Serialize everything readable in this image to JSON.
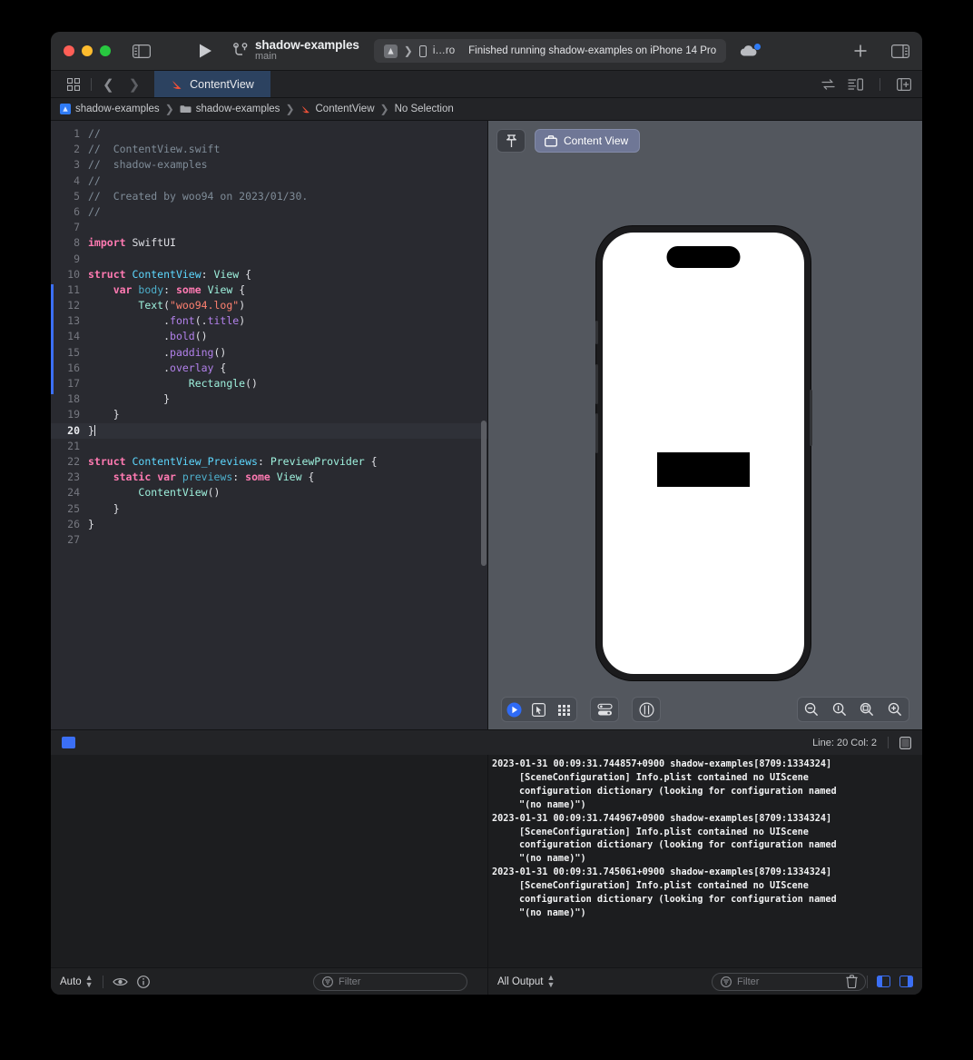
{
  "window": {
    "titlebar": {
      "scheme_name": "shadow-examples",
      "branch": "main",
      "activity": {
        "target": "i…ro",
        "status": "Finished running shadow-examples on iPhone 14 Pro"
      }
    },
    "tabbar": {
      "active_tab": "ContentView"
    },
    "breadcrumb": {
      "items": [
        "shadow-examples",
        "shadow-examples",
        "ContentView",
        "No Selection"
      ]
    }
  },
  "editor": {
    "lines": [
      {
        "n": "1",
        "tokens": [
          {
            "t": "//",
            "c": "c-cmt"
          }
        ]
      },
      {
        "n": "2",
        "tokens": [
          {
            "t": "//  ContentView.swift",
            "c": "c-cmt"
          }
        ]
      },
      {
        "n": "3",
        "tokens": [
          {
            "t": "//  shadow-examples",
            "c": "c-cmt"
          }
        ]
      },
      {
        "n": "4",
        "tokens": [
          {
            "t": "//",
            "c": "c-cmt"
          }
        ]
      },
      {
        "n": "5",
        "tokens": [
          {
            "t": "//  Created by woo94 on 2023/01/30.",
            "c": "c-cmt"
          }
        ]
      },
      {
        "n": "6",
        "tokens": [
          {
            "t": "//",
            "c": "c-cmt"
          }
        ]
      },
      {
        "n": "7",
        "tokens": []
      },
      {
        "n": "8",
        "tokens": [
          {
            "t": "import",
            "c": "c-kw"
          },
          {
            "t": " ",
            "c": "c-plain"
          },
          {
            "t": "SwiftUI",
            "c": "c-plain"
          }
        ]
      },
      {
        "n": "9",
        "tokens": []
      },
      {
        "n": "10",
        "tokens": [
          {
            "t": "struct",
            "c": "c-kw"
          },
          {
            "t": " ",
            "c": "c-plain"
          },
          {
            "t": "ContentView",
            "c": "c-type"
          },
          {
            "t": ": ",
            "c": "c-plain"
          },
          {
            "t": "View",
            "c": "c-type2"
          },
          {
            "t": " {",
            "c": "c-plain"
          }
        ]
      },
      {
        "n": "11",
        "tokens": [
          {
            "t": "    ",
            "c": "c-plain"
          },
          {
            "t": "var",
            "c": "c-kw"
          },
          {
            "t": " ",
            "c": "c-plain"
          },
          {
            "t": "body",
            "c": "c-var"
          },
          {
            "t": ": ",
            "c": "c-plain"
          },
          {
            "t": "some",
            "c": "c-kw"
          },
          {
            "t": " ",
            "c": "c-plain"
          },
          {
            "t": "View",
            "c": "c-type2"
          },
          {
            "t": " {",
            "c": "c-plain"
          }
        ]
      },
      {
        "n": "12",
        "tokens": [
          {
            "t": "        ",
            "c": "c-plain"
          },
          {
            "t": "Text",
            "c": "c-type2"
          },
          {
            "t": "(",
            "c": "c-plain"
          },
          {
            "t": "\"woo94.log\"",
            "c": "c-str"
          },
          {
            "t": ")",
            "c": "c-plain"
          }
        ]
      },
      {
        "n": "13",
        "tokens": [
          {
            "t": "            .",
            "c": "c-plain"
          },
          {
            "t": "font",
            "c": "c-mem"
          },
          {
            "t": "(.",
            "c": "c-plain"
          },
          {
            "t": "title",
            "c": "c-mem"
          },
          {
            "t": ")",
            "c": "c-plain"
          }
        ]
      },
      {
        "n": "14",
        "tokens": [
          {
            "t": "            .",
            "c": "c-plain"
          },
          {
            "t": "bold",
            "c": "c-mem"
          },
          {
            "t": "()",
            "c": "c-plain"
          }
        ]
      },
      {
        "n": "15",
        "tokens": [
          {
            "t": "            .",
            "c": "c-plain"
          },
          {
            "t": "padding",
            "c": "c-mem"
          },
          {
            "t": "()",
            "c": "c-plain"
          }
        ]
      },
      {
        "n": "16",
        "tokens": [
          {
            "t": "            .",
            "c": "c-plain"
          },
          {
            "t": "overlay",
            "c": "c-mem"
          },
          {
            "t": " {",
            "c": "c-plain"
          }
        ]
      },
      {
        "n": "17",
        "tokens": [
          {
            "t": "                ",
            "c": "c-plain"
          },
          {
            "t": "Rectangle",
            "c": "c-type2"
          },
          {
            "t": "()",
            "c": "c-plain"
          }
        ]
      },
      {
        "n": "18",
        "tokens": [
          {
            "t": "            }",
            "c": "c-plain"
          }
        ]
      },
      {
        "n": "19",
        "tokens": [
          {
            "t": "    }",
            "c": "c-plain"
          }
        ]
      },
      {
        "n": "20",
        "tokens": [
          {
            "t": "}",
            "c": "c-plain"
          }
        ],
        "current": true,
        "cursor": true
      },
      {
        "n": "21",
        "tokens": []
      },
      {
        "n": "22",
        "tokens": [
          {
            "t": "struct",
            "c": "c-kw"
          },
          {
            "t": " ",
            "c": "c-plain"
          },
          {
            "t": "ContentView_Previews",
            "c": "c-type"
          },
          {
            "t": ": ",
            "c": "c-plain"
          },
          {
            "t": "PreviewProvider",
            "c": "c-type2"
          },
          {
            "t": " {",
            "c": "c-plain"
          }
        ]
      },
      {
        "n": "23",
        "tokens": [
          {
            "t": "    ",
            "c": "c-plain"
          },
          {
            "t": "static",
            "c": "c-kw"
          },
          {
            "t": " ",
            "c": "c-plain"
          },
          {
            "t": "var",
            "c": "c-kw"
          },
          {
            "t": " ",
            "c": "c-plain"
          },
          {
            "t": "previews",
            "c": "c-var"
          },
          {
            "t": ": ",
            "c": "c-plain"
          },
          {
            "t": "some",
            "c": "c-kw"
          },
          {
            "t": " ",
            "c": "c-plain"
          },
          {
            "t": "View",
            "c": "c-type2"
          },
          {
            "t": " {",
            "c": "c-plain"
          }
        ]
      },
      {
        "n": "24",
        "tokens": [
          {
            "t": "        ",
            "c": "c-plain"
          },
          {
            "t": "ContentView",
            "c": "c-type2"
          },
          {
            "t": "()",
            "c": "c-plain"
          }
        ]
      },
      {
        "n": "25",
        "tokens": [
          {
            "t": "    }",
            "c": "c-plain"
          }
        ]
      },
      {
        "n": "26",
        "tokens": [
          {
            "t": "}",
            "c": "c-plain"
          }
        ]
      },
      {
        "n": "27",
        "tokens": []
      }
    ]
  },
  "canvas": {
    "preview_chip_label": "Content View"
  },
  "debugbar": {
    "position": "Line: 20  Col: 2"
  },
  "variables_panel": {
    "scope_label": "Auto",
    "filter_placeholder": "Filter"
  },
  "console": {
    "output_scope_label": "All Output",
    "filter_placeholder": "Filter",
    "entries": [
      {
        "head": "2023-01-31 00:09:31.744857+0900 shadow-examples[8709:1334324]",
        "body": [
          "[SceneConfiguration] Info.plist contained no UIScene",
          "configuration dictionary (looking for configuration named",
          "\"(no name)\")"
        ]
      },
      {
        "head": "2023-01-31 00:09:31.744967+0900 shadow-examples[8709:1334324]",
        "body": [
          "[SceneConfiguration] Info.plist contained no UIScene",
          "configuration dictionary (looking for configuration named",
          "\"(no name)\")"
        ]
      },
      {
        "head": "2023-01-31 00:09:31.745061+0900 shadow-examples[8709:1334324]",
        "body": [
          "[SceneConfiguration] Info.plist contained no UIScene",
          "configuration dictionary (looking for configuration named",
          "\"(no name)\")"
        ]
      }
    ]
  },
  "colors": {
    "accent_blue": "#3b6ff5",
    "tab_active": "#2c4260",
    "editor_bg": "#292a30",
    "canvas_bg": "#53575e",
    "chrome_bg": "#232427"
  }
}
